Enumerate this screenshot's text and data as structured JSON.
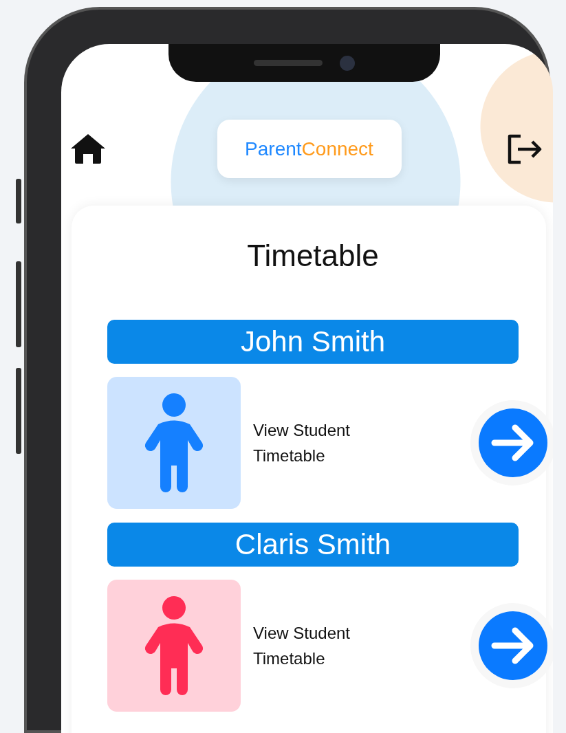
{
  "header": {
    "brand": [
      {
        "text": "Parent",
        "color": "#1e88ff"
      },
      {
        "text": "Connect",
        "color": "#ff9a1a"
      }
    ]
  },
  "page_title": "Timetable",
  "students": [
    {
      "name": "John Smith",
      "color": "#1580ff",
      "action": "View Student Timetable"
    },
    {
      "name": "Claris Smith",
      "color": "#ff2d55",
      "action": "View Student Timetable"
    }
  ]
}
